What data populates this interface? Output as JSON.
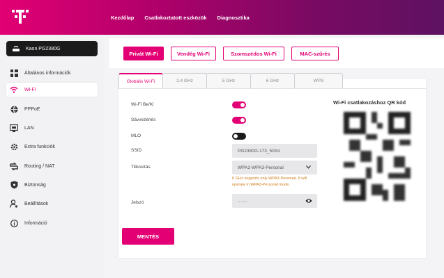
{
  "header": {
    "nav": [
      "Kezdőlap",
      "Csatlakoztatott eszközök",
      "Diagnosztika"
    ]
  },
  "sidebar": {
    "device": "Kaon PG2380G",
    "items": [
      {
        "label": "Általános információk",
        "icon": "info-grid-icon"
      },
      {
        "label": "Wi-Fi",
        "icon": "wifi-icon",
        "active": true
      },
      {
        "label": "PPPoE",
        "icon": "globe-icon"
      },
      {
        "label": "LAN",
        "icon": "monitor-icon"
      },
      {
        "label": "Extra funkciók",
        "icon": "gear-icon"
      },
      {
        "label": "Routing / NAT",
        "icon": "routing-icon"
      },
      {
        "label": "Biztonság",
        "icon": "shield-icon"
      },
      {
        "label": "Beállítások",
        "icon": "user-settings-icon"
      },
      {
        "label": "Információ",
        "icon": "info-circle-icon"
      }
    ]
  },
  "subtabs": [
    "Privát Wi-Fi",
    "Vendég Wi-Fi",
    "Szomszédos Wi-Fi",
    "MAC-szűrés"
  ],
  "bandtabs": [
    "Globális Wi-Fi",
    "2.4 GHz",
    "5 GHz",
    "6 GHz",
    "WPS"
  ],
  "form": {
    "wifi_toggle_label": "Wi-Fi Be/Ki",
    "wifi_on": true,
    "band_steering_label": "Sávvezérlés",
    "band_steering_on": true,
    "mlo_label": "MLO",
    "mlo_on": false,
    "ssid_label": "SSID",
    "ssid_value": "PG2380G-173_5Ghz",
    "encryption_label": "Titkosítás",
    "encryption_value": "WPA2-WPA3-Personal",
    "encryption_note": "6 GHz supports only WPA3-Personal. It will operate in WPA3-Personal mode.",
    "password_label": "Jelszó",
    "password_value": "........",
    "save_label": "MENTÉS"
  },
  "qr": {
    "title": "Wi-Fi csatlakozáshoz QR kód"
  },
  "colors": {
    "accent": "#e20074",
    "toggle_on": "#e20074",
    "toggle_off": "#1b1b1b",
    "warning_text": "#d07b1a"
  }
}
